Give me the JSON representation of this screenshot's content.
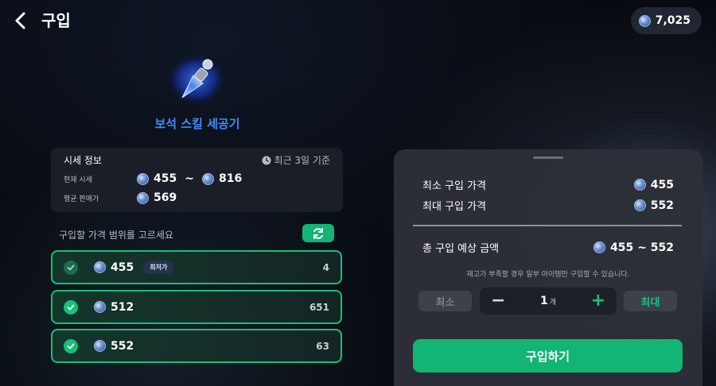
{
  "header": {
    "title": "구입",
    "back_icon": "chevron-left-icon",
    "balance": "7,025"
  },
  "item": {
    "name": "보석 스킬 세공기",
    "icon": "gem-chisel-icon"
  },
  "market": {
    "title": "시세 정보",
    "period": "최근 3일 기준",
    "current_label": "현재 시세",
    "current_min": "455",
    "current_sep": "~",
    "current_max": "816",
    "average_label": "평균 판매가",
    "average_value": "569"
  },
  "range": {
    "label": "구입할 가격 범위를 고르세요",
    "refresh_icon": "refresh-icon"
  },
  "options": [
    {
      "price": "455",
      "badge": "최저가",
      "count": "4",
      "checked": true
    },
    {
      "price": "512",
      "badge": "",
      "count": "651",
      "checked": true
    },
    {
      "price": "552",
      "badge": "",
      "count": "63",
      "checked": true
    }
  ],
  "panel": {
    "min_price_label": "최소 구입 가격",
    "min_price_value": "455",
    "max_price_label": "최대 구입 가격",
    "max_price_value": "552",
    "total_label": "총 구입 예상 금액",
    "total_value": "455 ~ 552",
    "notice": "재고가 부족할 경우 일부 아이템만 구입할 수 있습니다.",
    "min_button": "최소",
    "max_button": "최대",
    "quantity": "1",
    "quantity_unit": "개",
    "minus": "−",
    "plus": "+",
    "buy_button": "구입하기"
  },
  "colors": {
    "accent": "#12b573",
    "item_name": "#3b8cff",
    "background": "#070a10"
  }
}
